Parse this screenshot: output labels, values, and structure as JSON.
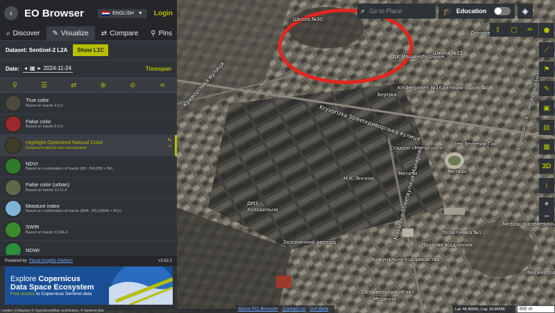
{
  "panel": {
    "back_glyph": "‹",
    "title": "EO Browser",
    "language": "ENGLISH",
    "login": "Login",
    "tabs": [
      {
        "label": "Discover",
        "icon": "search-icon",
        "glyph": "🔍"
      },
      {
        "label": "Visualize",
        "icon": "brush-icon",
        "glyph": "✎"
      },
      {
        "label": "Compare",
        "icon": "compare-icon",
        "glyph": "⇄"
      },
      {
        "label": "Pins",
        "icon": "pin-icon",
        "glyph": "📌"
      }
    ],
    "dataset_label": "Dataset: Sentinel-2 L2A",
    "show_l1c": "Show L1C",
    "date_label": "Date:",
    "date_value": "2024-11-24",
    "timespan": "Timespan",
    "tools": [
      "pin-icon",
      "sliders-icon",
      "swap-icon",
      "target-icon",
      "eye-off-icon",
      "share-icon"
    ],
    "layers": [
      {
        "title": "True color",
        "desc": "Based on bands 4,3,2",
        "color": "#4a4a3e"
      },
      {
        "title": "False color",
        "desc": "Based on bands 8,4,3",
        "color": "#9a2a2a"
      },
      {
        "title": "Highlight Optimized Natural Color",
        "desc": "Enhanced natural color visualization",
        "color": "#3e3d2c",
        "selected": true
      },
      {
        "title": "NDVI",
        "desc": "Based on combination of bands (B8 - B4)/(B8 + B4)",
        "color": "#2f7a2a"
      },
      {
        "title": "False color (urban)",
        "desc": "Based on bands 12,11,4",
        "color": "#5d6a4a"
      },
      {
        "title": "Moisture index",
        "desc": "Based on combination of bands (B8A - B11)/(B8A + B11)",
        "color": "#7fb3d8"
      },
      {
        "title": "SWIR",
        "desc": "Based on bands 12,8A,4",
        "color": "#3b8a2e"
      },
      {
        "title": "NDWI",
        "desc": "",
        "color": "#2c8f3b"
      }
    ],
    "powered_by": "Powered by",
    "powered_link": "Planet Insights Platform",
    "version": "v3.62.2",
    "banner": {
      "line1": "Explore",
      "line1_bold": "Copernicus",
      "line2": "Data Space Ecosystem",
      "sub_prefix": "Free access",
      "sub_rest": "to Copernicus Sentinel data"
    }
  },
  "search": {
    "placeholder": "Go to Place"
  },
  "education": {
    "label": "Education",
    "enabled": false
  },
  "map_labels": [
    {
      "text": "Школа №30",
      "cls": ""
    },
    {
      "text": "Криворізька вулиця",
      "cls": "street"
    },
    {
      "text": "Kryvorizka Streetкриворізька вулиця",
      "cls": "street"
    },
    {
      "text": "ДК Машинобудівник",
      "cls": ""
    },
    {
      "text": "Школа №15",
      "cls": ""
    },
    {
      "text": "Kindergarten №16дитячий садок №16",
      "cls": ""
    },
    {
      "text": "Берізка",
      "cls": ""
    },
    {
      "text": "Стадіон «Металург»",
      "cls": ""
    },
    {
      "text": "Метизи",
      "cls": ""
    },
    {
      "text": "Метизи",
      "cls": ""
    },
    {
      "text": "М.К. Янгеля",
      "cls": ""
    },
    {
      "text": "Makarova Streetвулиця Макарова",
      "cls": "street"
    },
    {
      "text": "ДМЗ",
      "cls": ""
    },
    {
      "text": "Холодильна",
      "cls": ""
    },
    {
      "text": "Залізничний переїзд",
      "cls": ""
    },
    {
      "text": "Полікліника №1",
      "cls": ""
    },
    {
      "text": "Полтове відділення",
      "cls": ""
    },
    {
      "text": "Комунальне підприємство",
      "cls": ""
    },
    {
      "text": "Будівельний об'єкт",
      "cls": ""
    },
    {
      "text": "Медична",
      "cls": ""
    },
    {
      "text": "Зер Зелений Гай",
      "cls": ""
    },
    {
      "text": "Independence Streetвулиця Незалежності",
      "cls": ""
    },
    {
      "text": "Medical plantMedична фабрика",
      "cls": ""
    },
    {
      "text": "Nezalezhnosti",
      "cls": ""
    },
    {
      "text": "Дніпровська",
      "cls": ""
    }
  ],
  "coords": "Lat: 48.40586, Lng: 34.96556",
  "scale": "300 m",
  "bottom_links": [
    "About EO Browser",
    "Contact us",
    "Get data"
  ],
  "attribution": "Leaflet | © Mapbox © OpenStreetMap contributors, © Sentinel Hub"
}
